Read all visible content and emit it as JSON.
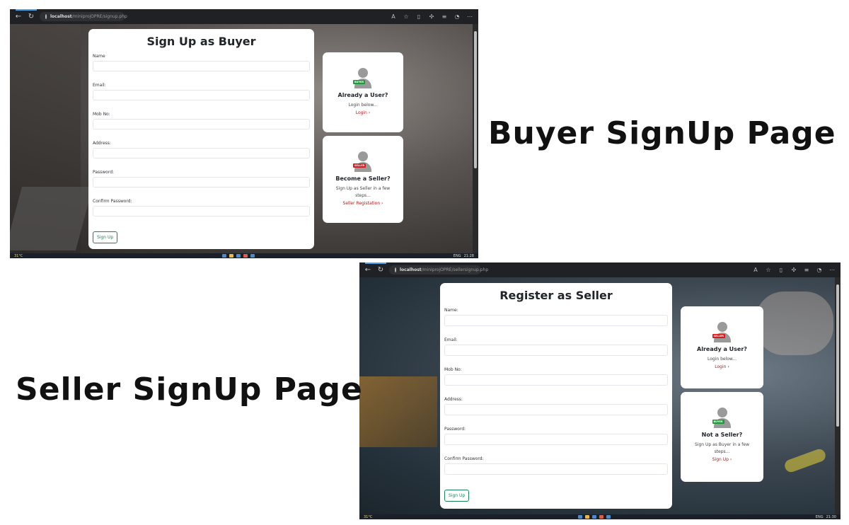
{
  "captions": {
    "buyer": "Buyer SignUp Page",
    "seller": "Seller SignUp Page"
  },
  "buyer_screenshot": {
    "browser": {
      "url_host": "localhost",
      "url_path": "/miniprojOPRE/signup.php"
    },
    "form": {
      "title": "Sign Up as Buyer",
      "fields": [
        {
          "label": "Name"
        },
        {
          "label": "Email:"
        },
        {
          "label": "Mob No:"
        },
        {
          "label": "Address:"
        },
        {
          "label": "Password:"
        },
        {
          "label": "Confirm Password:"
        }
      ],
      "submit_label": "Sign Up"
    },
    "card_login": {
      "badge": "BUYER",
      "heading": "Already a User?",
      "text": "Login below...",
      "link": "Login ›"
    },
    "card_other": {
      "badge": "SELLER",
      "heading": "Become a Seller?",
      "text": "Sign Up as Seller in a few steps...",
      "link": "Seller Registation ›"
    },
    "taskbar": {
      "weather": "31°C",
      "time": "21:28",
      "lang": "ENG"
    }
  },
  "seller_screenshot": {
    "browser": {
      "url_host": "localhost",
      "url_path": "/miniprojOPRE/sellersignup.php"
    },
    "form": {
      "title": "Register as Seller",
      "fields": [
        {
          "label": "Name:"
        },
        {
          "label": "Email:"
        },
        {
          "label": "Mob No:"
        },
        {
          "label": "Address:"
        },
        {
          "label": "Password:"
        },
        {
          "label": "Confirm Password:"
        }
      ],
      "submit_label": "Sign Up"
    },
    "card_login": {
      "badge": "SELLER",
      "heading": "Already a User?",
      "text": "Login below...",
      "link": "Login ›"
    },
    "card_other": {
      "badge": "BUYER",
      "heading": "Not a Seller?",
      "text": "Sign Up as Buyer in a few steps...",
      "link": "Sign Up ›"
    },
    "taskbar": {
      "weather": "31°C",
      "time": "21:30",
      "lang": "ENG"
    }
  },
  "colors": {
    "link": "#9c1c1c",
    "submit": "#198754",
    "buyer_badge": "#1e9a3a",
    "seller_badge": "#d11e1e"
  }
}
